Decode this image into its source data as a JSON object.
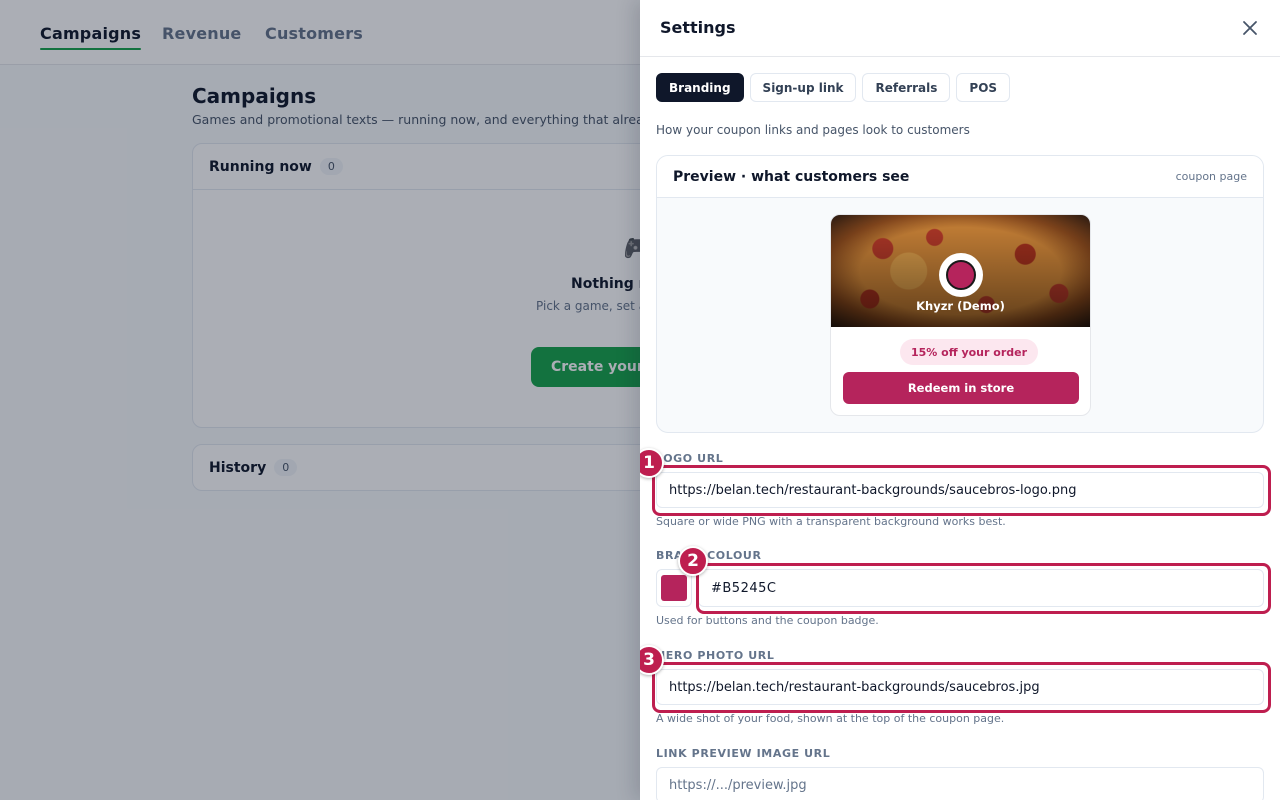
{
  "nav": {
    "tabs": [
      {
        "label": "Campaigns",
        "active": true
      },
      {
        "label": "Revenue",
        "active": false
      },
      {
        "label": "Customers",
        "active": false
      }
    ]
  },
  "main": {
    "title": "Campaigns",
    "subtitle": "Games and promotional texts — running now, and everything that already we",
    "running": {
      "title": "Running now",
      "count": "0",
      "empty_icon": "gamepad-icon",
      "empty_title": "Nothing ru",
      "empty_text": "Pick a game, set a prize, test it o… takes it fr",
      "cta_label": "Create your fi"
    },
    "history": {
      "title": "History",
      "count": "0"
    }
  },
  "drawer": {
    "title": "Settings",
    "close_icon": "close-icon",
    "tabs": [
      {
        "label": "Branding",
        "active": true
      },
      {
        "label": "Sign-up link",
        "active": false
      },
      {
        "label": "Referrals",
        "active": false
      },
      {
        "label": "POS",
        "active": false
      }
    ],
    "section_description": "How your coupon links and pages look to customers",
    "preview": {
      "title": "Preview · what customers see",
      "meta": "coupon page",
      "brand_name": "Khyzr (Demo)",
      "offer_badge": "15% off your order",
      "redeem_label": "Redeem in store"
    },
    "fields": {
      "logo_url": {
        "label": "LOGO URL",
        "value": "https://belan.tech/restaurant-backgrounds/saucebros-logo.png",
        "hint": "Square or wide PNG with a transparent background works best."
      },
      "brand_colour": {
        "label": "BRAND COLOUR",
        "value": "#B5245C",
        "hint": "Used for buttons and the coupon badge."
      },
      "hero_photo_url": {
        "label": "HERO PHOTO URL",
        "value": "https://belan.tech/restaurant-backgrounds/saucebros.jpg",
        "hint": "A wide shot of your food, shown at the top of the coupon page."
      },
      "link_preview_url": {
        "label": "LINK PREVIEW IMAGE URL",
        "placeholder": "https://.../preview.jpg"
      }
    }
  },
  "annotations": [
    {
      "number": "1"
    },
    {
      "number": "2"
    },
    {
      "number": "3"
    }
  ],
  "colors": {
    "brand": "#B5245C",
    "accent_green": "#16A34A",
    "annotation": "#BE1E4F",
    "dark": "#0F172A"
  }
}
